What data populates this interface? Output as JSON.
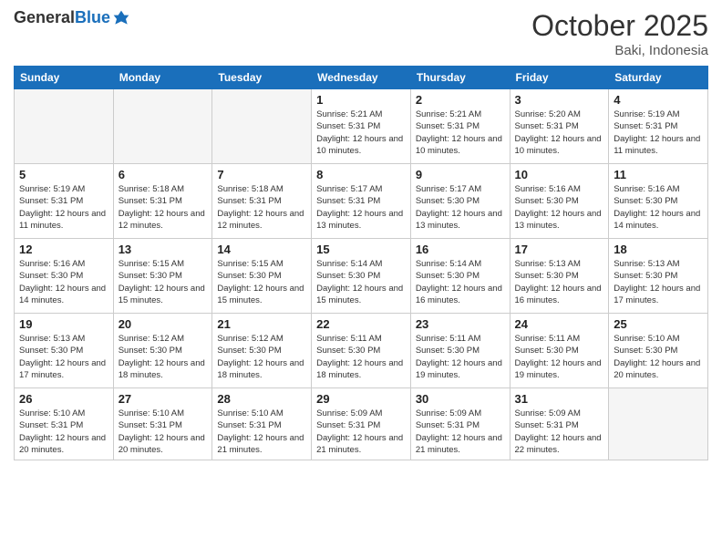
{
  "header": {
    "logo_general": "General",
    "logo_blue": "Blue",
    "month": "October 2025",
    "location": "Baki, Indonesia"
  },
  "weekdays": [
    "Sunday",
    "Monday",
    "Tuesday",
    "Wednesday",
    "Thursday",
    "Friday",
    "Saturday"
  ],
  "weeks": [
    [
      {
        "day": "",
        "empty": true
      },
      {
        "day": "",
        "empty": true
      },
      {
        "day": "",
        "empty": true
      },
      {
        "day": "1",
        "sunrise": "5:21 AM",
        "sunset": "5:31 PM",
        "daylight": "12 hours and 10 minutes."
      },
      {
        "day": "2",
        "sunrise": "5:21 AM",
        "sunset": "5:31 PM",
        "daylight": "12 hours and 10 minutes."
      },
      {
        "day": "3",
        "sunrise": "5:20 AM",
        "sunset": "5:31 PM",
        "daylight": "12 hours and 10 minutes."
      },
      {
        "day": "4",
        "sunrise": "5:19 AM",
        "sunset": "5:31 PM",
        "daylight": "12 hours and 11 minutes."
      }
    ],
    [
      {
        "day": "5",
        "sunrise": "5:19 AM",
        "sunset": "5:31 PM",
        "daylight": "12 hours and 11 minutes."
      },
      {
        "day": "6",
        "sunrise": "5:18 AM",
        "sunset": "5:31 PM",
        "daylight": "12 hours and 12 minutes."
      },
      {
        "day": "7",
        "sunrise": "5:18 AM",
        "sunset": "5:31 PM",
        "daylight": "12 hours and 12 minutes."
      },
      {
        "day": "8",
        "sunrise": "5:17 AM",
        "sunset": "5:31 PM",
        "daylight": "12 hours and 13 minutes."
      },
      {
        "day": "9",
        "sunrise": "5:17 AM",
        "sunset": "5:30 PM",
        "daylight": "12 hours and 13 minutes."
      },
      {
        "day": "10",
        "sunrise": "5:16 AM",
        "sunset": "5:30 PM",
        "daylight": "12 hours and 13 minutes."
      },
      {
        "day": "11",
        "sunrise": "5:16 AM",
        "sunset": "5:30 PM",
        "daylight": "12 hours and 14 minutes."
      }
    ],
    [
      {
        "day": "12",
        "sunrise": "5:16 AM",
        "sunset": "5:30 PM",
        "daylight": "12 hours and 14 minutes."
      },
      {
        "day": "13",
        "sunrise": "5:15 AM",
        "sunset": "5:30 PM",
        "daylight": "12 hours and 15 minutes."
      },
      {
        "day": "14",
        "sunrise": "5:15 AM",
        "sunset": "5:30 PM",
        "daylight": "12 hours and 15 minutes."
      },
      {
        "day": "15",
        "sunrise": "5:14 AM",
        "sunset": "5:30 PM",
        "daylight": "12 hours and 15 minutes."
      },
      {
        "day": "16",
        "sunrise": "5:14 AM",
        "sunset": "5:30 PM",
        "daylight": "12 hours and 16 minutes."
      },
      {
        "day": "17",
        "sunrise": "5:13 AM",
        "sunset": "5:30 PM",
        "daylight": "12 hours and 16 minutes."
      },
      {
        "day": "18",
        "sunrise": "5:13 AM",
        "sunset": "5:30 PM",
        "daylight": "12 hours and 17 minutes."
      }
    ],
    [
      {
        "day": "19",
        "sunrise": "5:13 AM",
        "sunset": "5:30 PM",
        "daylight": "12 hours and 17 minutes."
      },
      {
        "day": "20",
        "sunrise": "5:12 AM",
        "sunset": "5:30 PM",
        "daylight": "12 hours and 18 minutes."
      },
      {
        "day": "21",
        "sunrise": "5:12 AM",
        "sunset": "5:30 PM",
        "daylight": "12 hours and 18 minutes."
      },
      {
        "day": "22",
        "sunrise": "5:11 AM",
        "sunset": "5:30 PM",
        "daylight": "12 hours and 18 minutes."
      },
      {
        "day": "23",
        "sunrise": "5:11 AM",
        "sunset": "5:30 PM",
        "daylight": "12 hours and 19 minutes."
      },
      {
        "day": "24",
        "sunrise": "5:11 AM",
        "sunset": "5:30 PM",
        "daylight": "12 hours and 19 minutes."
      },
      {
        "day": "25",
        "sunrise": "5:10 AM",
        "sunset": "5:30 PM",
        "daylight": "12 hours and 20 minutes."
      }
    ],
    [
      {
        "day": "26",
        "sunrise": "5:10 AM",
        "sunset": "5:31 PM",
        "daylight": "12 hours and 20 minutes."
      },
      {
        "day": "27",
        "sunrise": "5:10 AM",
        "sunset": "5:31 PM",
        "daylight": "12 hours and 20 minutes."
      },
      {
        "day": "28",
        "sunrise": "5:10 AM",
        "sunset": "5:31 PM",
        "daylight": "12 hours and 21 minutes."
      },
      {
        "day": "29",
        "sunrise": "5:09 AM",
        "sunset": "5:31 PM",
        "daylight": "12 hours and 21 minutes."
      },
      {
        "day": "30",
        "sunrise": "5:09 AM",
        "sunset": "5:31 PM",
        "daylight": "12 hours and 21 minutes."
      },
      {
        "day": "31",
        "sunrise": "5:09 AM",
        "sunset": "5:31 PM",
        "daylight": "12 hours and 22 minutes."
      },
      {
        "day": "",
        "empty": true
      }
    ]
  ],
  "labels": {
    "sunrise": "Sunrise:",
    "sunset": "Sunset:",
    "daylight": "Daylight:"
  }
}
